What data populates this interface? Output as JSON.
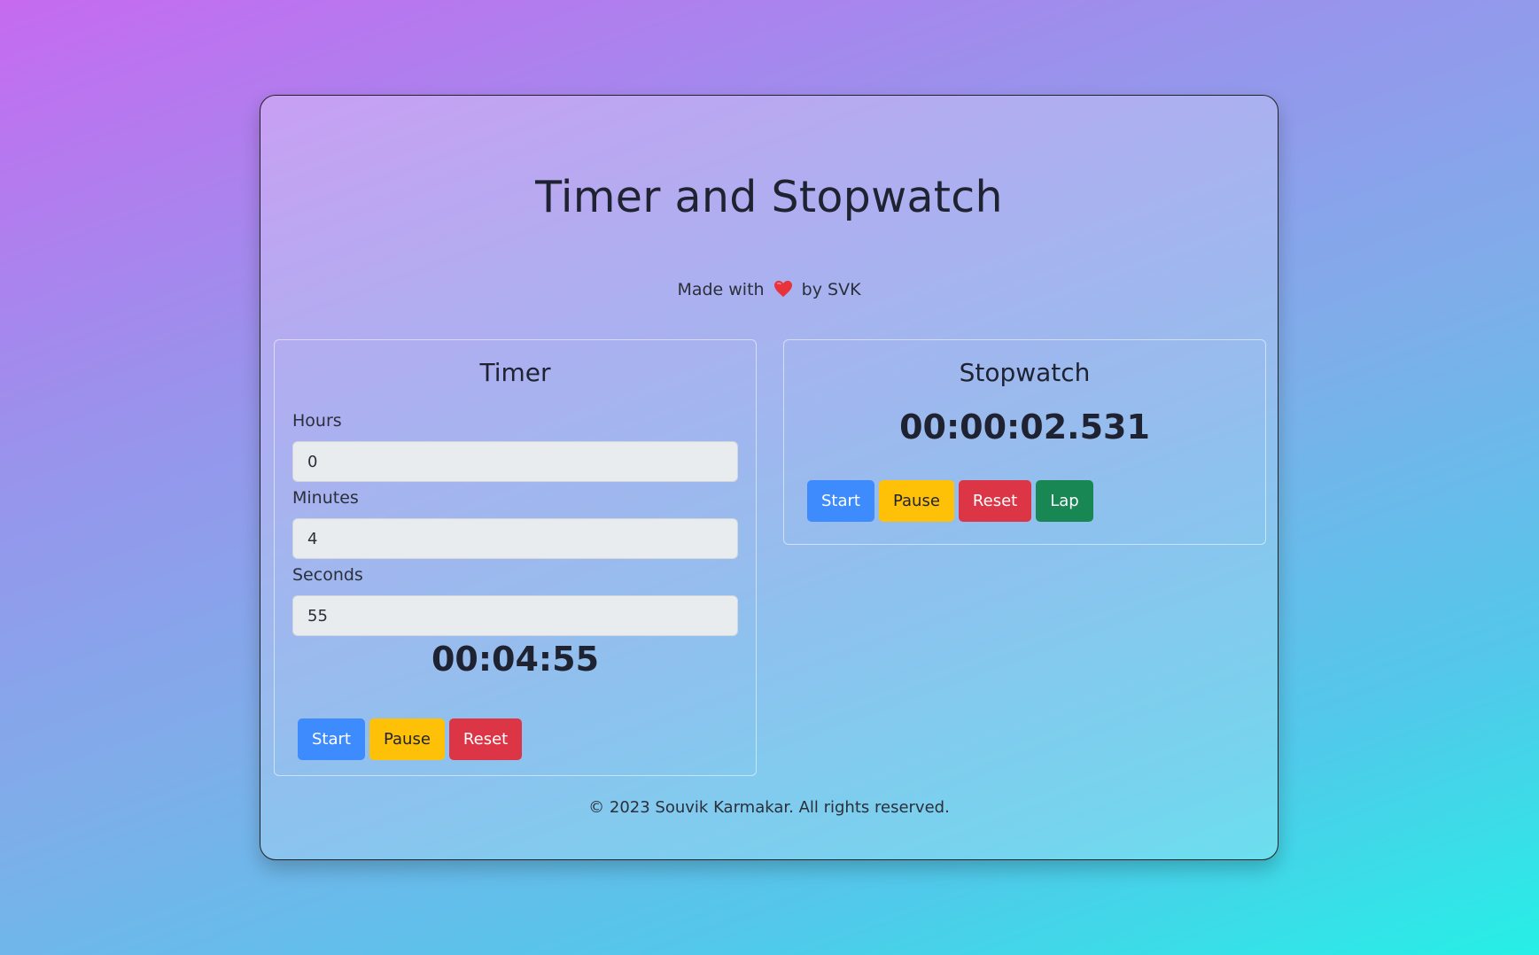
{
  "page": {
    "title": "Timer and Stopwatch",
    "credit_prefix": "Made with",
    "credit_suffix": "by SVK",
    "heart_icon": "heart-icon",
    "heart_color": "#e8323c",
    "footer": "© 2023 Souvik Karmakar. All rights reserved."
  },
  "timer": {
    "title": "Timer",
    "hours_label": "Hours",
    "hours_value": "0",
    "minutes_label": "Minutes",
    "minutes_value": "4",
    "seconds_label": "Seconds",
    "seconds_value": "55",
    "display": "00:04:55",
    "buttons": {
      "start": "Start",
      "pause": "Pause",
      "reset": "Reset"
    }
  },
  "stopwatch": {
    "title": "Stopwatch",
    "display": "00:00:02.531",
    "buttons": {
      "start": "Start",
      "pause": "Pause",
      "reset": "Reset",
      "lap": "Lap"
    }
  },
  "colors": {
    "start": "#3d8bfd",
    "pause": "#ffc107",
    "reset": "#dc3545",
    "lap": "#198754"
  }
}
